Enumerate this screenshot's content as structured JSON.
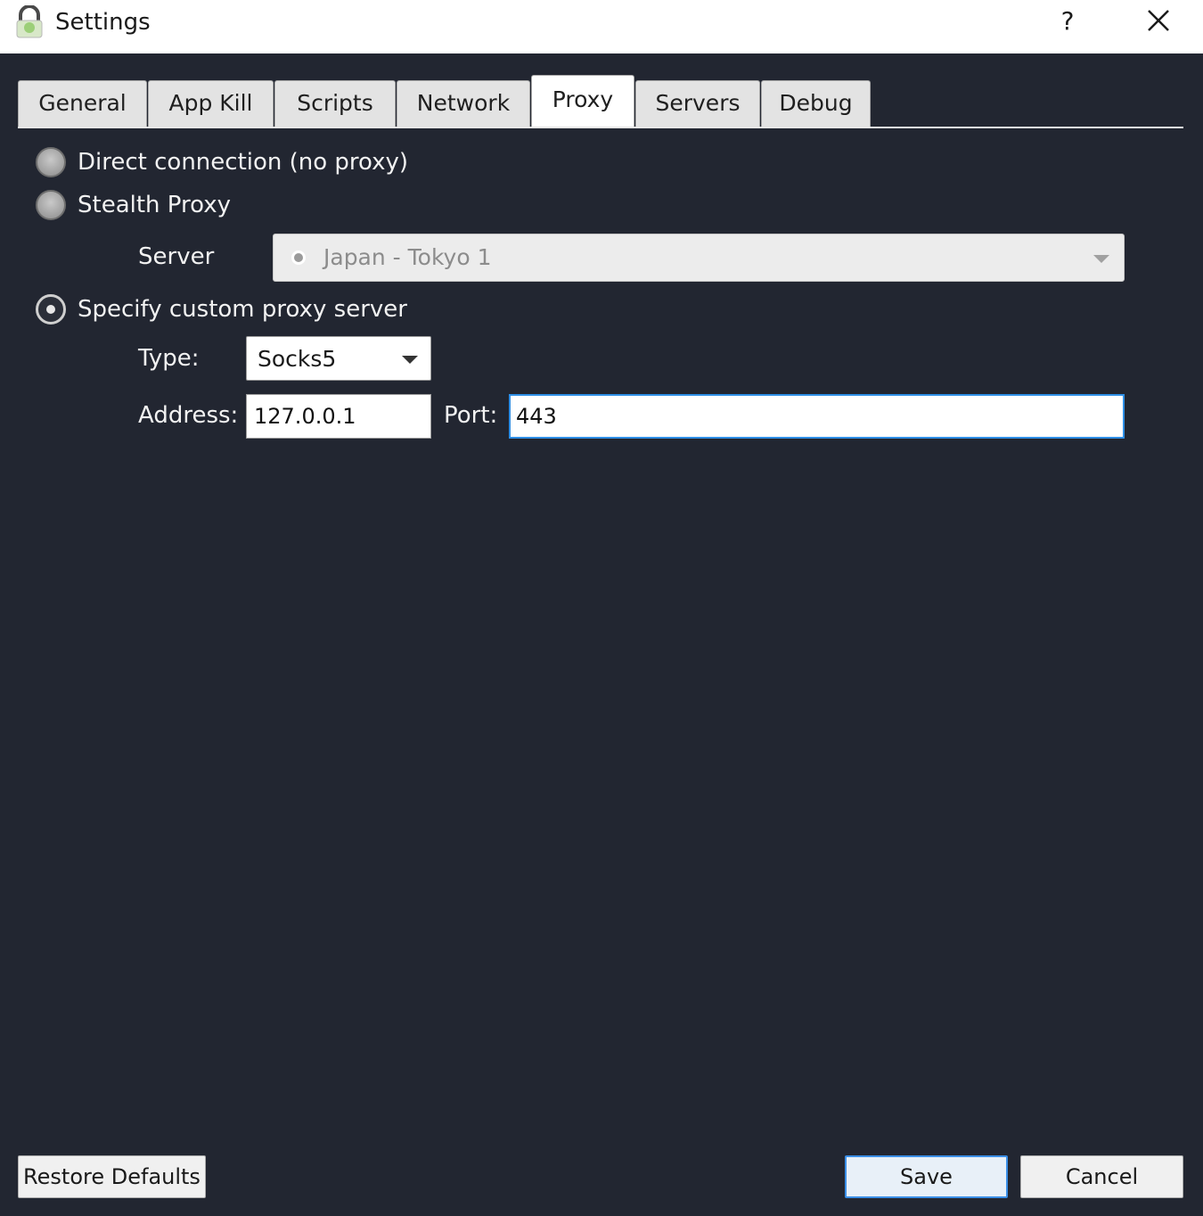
{
  "window": {
    "title": "Settings",
    "help_label": "?"
  },
  "tabs": [
    {
      "label": "General"
    },
    {
      "label": "App Kill"
    },
    {
      "label": "Scripts"
    },
    {
      "label": "Network"
    },
    {
      "label": "Proxy"
    },
    {
      "label": "Servers"
    },
    {
      "label": "Debug"
    }
  ],
  "active_tab": "Proxy",
  "proxy": {
    "direct_label": "Direct connection (no proxy)",
    "stealth_label": "Stealth Proxy",
    "custom_label": "Specify custom proxy server",
    "selected": "custom",
    "server_label": "Server",
    "server_value": "Japan - Tokyo 1",
    "type_label": "Type:",
    "type_value": "Socks5",
    "address_label": "Address:",
    "address_value": "127.0.0.1",
    "port_label": "Port:",
    "port_value": "443"
  },
  "buttons": {
    "restore_defaults": "Restore Defaults",
    "save": "Save",
    "cancel": "Cancel"
  },
  "colors": {
    "background": "#222631",
    "accent": "#3a8ee6"
  }
}
